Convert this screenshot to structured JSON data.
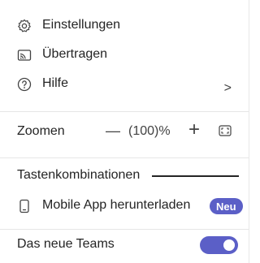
{
  "menu": {
    "settings": {
      "label": "Einstellungen",
      "icon": "gear-icon"
    },
    "cast": {
      "label": "Übertragen",
      "icon": "cast-icon"
    },
    "help": {
      "label": "Hilfe",
      "icon": "help-circle-icon",
      "chevron": ">"
    },
    "zoom": {
      "label": "Zoomen",
      "minus": "—",
      "value": "(100)%",
      "plus": "+",
      "fullscreen_icon": "fullscreen-icon"
    },
    "shortcuts": {
      "label": "Tastenkombinationen"
    },
    "mobile": {
      "label": "Mobile App herunterladen",
      "icon": "phone-icon",
      "badge": "Neu"
    },
    "new_teams": {
      "label": "Das neue Teams",
      "toggle_on": true
    }
  },
  "colors": {
    "accent": "#5b5fc7",
    "text": "#242424",
    "divider": "#e6e6e6"
  }
}
